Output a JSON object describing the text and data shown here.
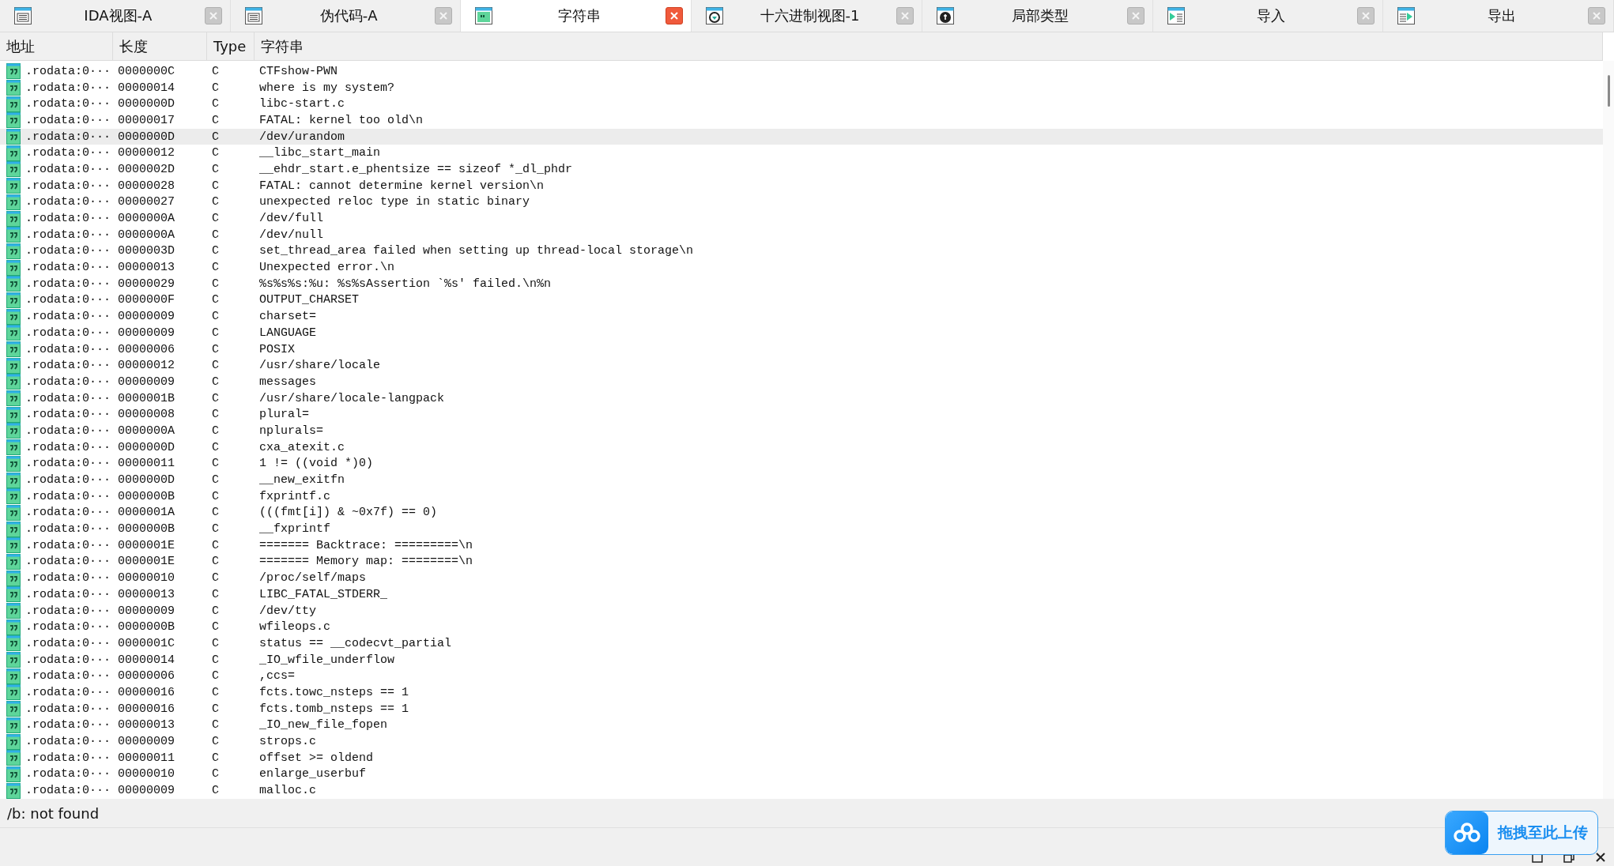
{
  "tabs": [
    {
      "label": "IDA视图-A",
      "kind": "listing",
      "selected": false
    },
    {
      "label": "伪代码-A",
      "kind": "pseudocode",
      "selected": false
    },
    {
      "label": "字符串",
      "kind": "strings",
      "selected": true
    },
    {
      "label": "十六进制视图-1",
      "kind": "hex",
      "selected": false
    },
    {
      "label": "局部类型",
      "kind": "types",
      "selected": false
    },
    {
      "label": "导入",
      "kind": "imports",
      "selected": false
    },
    {
      "label": "导出",
      "kind": "exports",
      "selected": false
    }
  ],
  "table": {
    "columns": [
      "地址",
      "长度",
      "Type",
      "字符串"
    ],
    "rows": [
      {
        "address": ".rodata:0···",
        "length": "0000000C",
        "type": "C",
        "string": "CTFshow-PWN",
        "selected": false
      },
      {
        "address": ".rodata:0···",
        "length": "00000014",
        "type": "C",
        "string": "where is my system?",
        "selected": false
      },
      {
        "address": ".rodata:0···",
        "length": "0000000D",
        "type": "C",
        "string": "libc-start.c",
        "selected": false
      },
      {
        "address": ".rodata:0···",
        "length": "00000017",
        "type": "C",
        "string": "FATAL: kernel too old\\n",
        "selected": false
      },
      {
        "address": ".rodata:0···",
        "length": "0000000D",
        "type": "C",
        "string": "/dev/urandom",
        "selected": true
      },
      {
        "address": ".rodata:0···",
        "length": "00000012",
        "type": "C",
        "string": "__libc_start_main",
        "selected": false
      },
      {
        "address": ".rodata:0···",
        "length": "0000002D",
        "type": "C",
        "string": "__ehdr_start.e_phentsize == sizeof *_dl_phdr",
        "selected": false
      },
      {
        "address": ".rodata:0···",
        "length": "00000028",
        "type": "C",
        "string": "FATAL: cannot determine kernel version\\n",
        "selected": false
      },
      {
        "address": ".rodata:0···",
        "length": "00000027",
        "type": "C",
        "string": "unexpected reloc type in static binary",
        "selected": false
      },
      {
        "address": ".rodata:0···",
        "length": "0000000A",
        "type": "C",
        "string": "/dev/full",
        "selected": false
      },
      {
        "address": ".rodata:0···",
        "length": "0000000A",
        "type": "C",
        "string": "/dev/null",
        "selected": false
      },
      {
        "address": ".rodata:0···",
        "length": "0000003D",
        "type": "C",
        "string": "set_thread_area failed when setting up thread-local storage\\n",
        "selected": false
      },
      {
        "address": ".rodata:0···",
        "length": "00000013",
        "type": "C",
        "string": "Unexpected error.\\n",
        "selected": false
      },
      {
        "address": ".rodata:0···",
        "length": "00000029",
        "type": "C",
        "string": "%s%s%s:%u: %s%sAssertion `%s' failed.\\n%n",
        "selected": false
      },
      {
        "address": ".rodata:0···",
        "length": "0000000F",
        "type": "C",
        "string": "OUTPUT_CHARSET",
        "selected": false
      },
      {
        "address": ".rodata:0···",
        "length": "00000009",
        "type": "C",
        "string": "charset=",
        "selected": false
      },
      {
        "address": ".rodata:0···",
        "length": "00000009",
        "type": "C",
        "string": "LANGUAGE",
        "selected": false
      },
      {
        "address": ".rodata:0···",
        "length": "00000006",
        "type": "C",
        "string": "POSIX",
        "selected": false
      },
      {
        "address": ".rodata:0···",
        "length": "00000012",
        "type": "C",
        "string": "/usr/share/locale",
        "selected": false
      },
      {
        "address": ".rodata:0···",
        "length": "00000009",
        "type": "C",
        "string": "messages",
        "selected": false
      },
      {
        "address": ".rodata:0···",
        "length": "0000001B",
        "type": "C",
        "string": "/usr/share/locale-langpack",
        "selected": false
      },
      {
        "address": ".rodata:0···",
        "length": "00000008",
        "type": "C",
        "string": "plural=",
        "selected": false
      },
      {
        "address": ".rodata:0···",
        "length": "0000000A",
        "type": "C",
        "string": "nplurals=",
        "selected": false
      },
      {
        "address": ".rodata:0···",
        "length": "0000000D",
        "type": "C",
        "string": "cxa_atexit.c",
        "selected": false
      },
      {
        "address": ".rodata:0···",
        "length": "00000011",
        "type": "C",
        "string": "1 != ((void *)0)",
        "selected": false
      },
      {
        "address": ".rodata:0···",
        "length": "0000000D",
        "type": "C",
        "string": "__new_exitfn",
        "selected": false
      },
      {
        "address": ".rodata:0···",
        "length": "0000000B",
        "type": "C",
        "string": "fxprintf.c",
        "selected": false
      },
      {
        "address": ".rodata:0···",
        "length": "0000001A",
        "type": "C",
        "string": "(((fmt[i]) & ~0x7f) == 0)",
        "selected": false
      },
      {
        "address": ".rodata:0···",
        "length": "0000000B",
        "type": "C",
        "string": "__fxprintf",
        "selected": false
      },
      {
        "address": ".rodata:0···",
        "length": "0000001E",
        "type": "C",
        "string": "======= Backtrace: =========\\n",
        "selected": false
      },
      {
        "address": ".rodata:0···",
        "length": "0000001E",
        "type": "C",
        "string": "======= Memory map: ========\\n",
        "selected": false
      },
      {
        "address": ".rodata:0···",
        "length": "00000010",
        "type": "C",
        "string": "/proc/self/maps",
        "selected": false
      },
      {
        "address": ".rodata:0···",
        "length": "00000013",
        "type": "C",
        "string": "LIBC_FATAL_STDERR_",
        "selected": false
      },
      {
        "address": ".rodata:0···",
        "length": "00000009",
        "type": "C",
        "string": "/dev/tty",
        "selected": false
      },
      {
        "address": ".rodata:0···",
        "length": "0000000B",
        "type": "C",
        "string": "wfileops.c",
        "selected": false
      },
      {
        "address": ".rodata:0···",
        "length": "0000001C",
        "type": "C",
        "string": "status == __codecvt_partial",
        "selected": false
      },
      {
        "address": ".rodata:0···",
        "length": "00000014",
        "type": "C",
        "string": "_IO_wfile_underflow",
        "selected": false
      },
      {
        "address": ".rodata:0···",
        "length": "00000006",
        "type": "C",
        "string": ",ccs=",
        "selected": false
      },
      {
        "address": ".rodata:0···",
        "length": "00000016",
        "type": "C",
        "string": "fcts.towc_nsteps == 1",
        "selected": false
      },
      {
        "address": ".rodata:0···",
        "length": "00000016",
        "type": "C",
        "string": "fcts.tomb_nsteps == 1",
        "selected": false
      },
      {
        "address": ".rodata:0···",
        "length": "00000013",
        "type": "C",
        "string": "_IO_new_file_fopen",
        "selected": false
      },
      {
        "address": ".rodata:0···",
        "length": "00000009",
        "type": "C",
        "string": "strops.c",
        "selected": false
      },
      {
        "address": ".rodata:0···",
        "length": "00000011",
        "type": "C",
        "string": "offset >= oldend",
        "selected": false
      },
      {
        "address": ".rodata:0···",
        "length": "00000010",
        "type": "C",
        "string": "enlarge_userbuf",
        "selected": false
      },
      {
        "address": ".rodata:0···",
        "length": "00000009",
        "type": "C",
        "string": "malloc.c",
        "selected": false
      }
    ]
  },
  "status_bar": {
    "message": "/b: not found"
  },
  "upload_widget": {
    "label": "拖拽至此上传"
  }
}
